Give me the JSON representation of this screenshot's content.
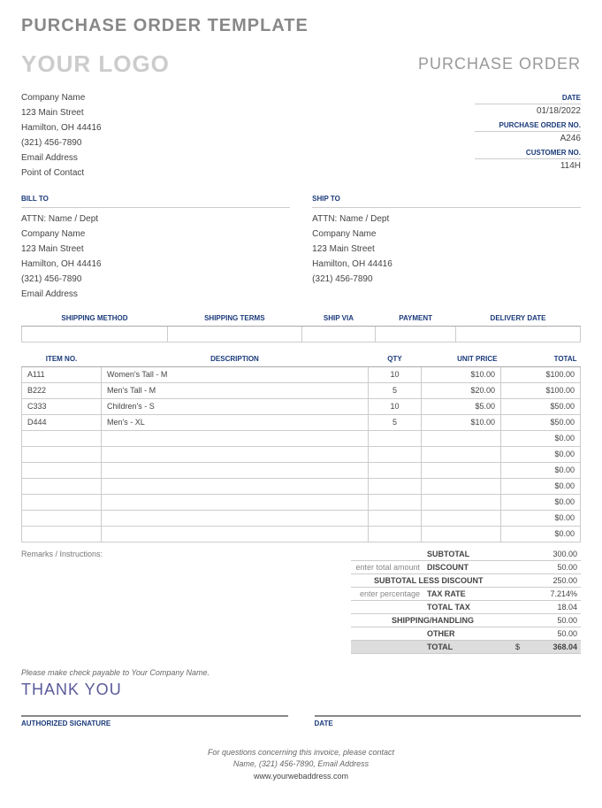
{
  "title": "PURCHASE ORDER TEMPLATE",
  "logo": "YOUR LOGO",
  "po_label": "PURCHASE ORDER",
  "company": {
    "name": "Company Name",
    "street": "123 Main Street",
    "city": "Hamilton, OH 44416",
    "phone": "(321) 456-7890",
    "email": "Email Address",
    "contact": "Point of Contact"
  },
  "meta": {
    "date_label": "DATE",
    "date": "01/18/2022",
    "po_no_label": "PURCHASE ORDER NO.",
    "po_no": "A246",
    "cust_no_label": "CUSTOMER NO.",
    "cust_no": "114H"
  },
  "bill_to": {
    "label": "BILL TO",
    "attn": "ATTN: Name / Dept",
    "company": "Company Name",
    "street": "123 Main Street",
    "city": "Hamilton, OH 44416",
    "phone": "(321) 456-7890",
    "email": "Email Address"
  },
  "ship_to": {
    "label": "SHIP TO",
    "attn": "ATTN: Name / Dept",
    "company": "Company Name",
    "street": "123 Main Street",
    "city": "Hamilton, OH 44416",
    "phone": "(321) 456-7890"
  },
  "ship_headers": {
    "method": "SHIPPING METHOD",
    "terms": "SHIPPING TERMS",
    "via": "SHIP VIA",
    "payment": "PAYMENT",
    "delivery": "DELIVERY DATE"
  },
  "item_headers": {
    "no": "ITEM NO.",
    "desc": "DESCRIPTION",
    "qty": "QTY",
    "price": "UNIT PRICE",
    "total": "TOTAL"
  },
  "items": [
    {
      "no": "A111",
      "desc": "Women's Tall - M",
      "qty": "10",
      "price": "$10.00",
      "total": "$100.00"
    },
    {
      "no": "B222",
      "desc": "Men's Tall - M",
      "qty": "5",
      "price": "$20.00",
      "total": "$100.00"
    },
    {
      "no": "C333",
      "desc": "Children's - S",
      "qty": "10",
      "price": "$5.00",
      "total": "$50.00"
    },
    {
      "no": "D444",
      "desc": "Men's - XL",
      "qty": "5",
      "price": "$10.00",
      "total": "$50.00"
    },
    {
      "no": "",
      "desc": "",
      "qty": "",
      "price": "",
      "total": "$0.00"
    },
    {
      "no": "",
      "desc": "",
      "qty": "",
      "price": "",
      "total": "$0.00"
    },
    {
      "no": "",
      "desc": "",
      "qty": "",
      "price": "",
      "total": "$0.00"
    },
    {
      "no": "",
      "desc": "",
      "qty": "",
      "price": "",
      "total": "$0.00"
    },
    {
      "no": "",
      "desc": "",
      "qty": "",
      "price": "",
      "total": "$0.00"
    },
    {
      "no": "",
      "desc": "",
      "qty": "",
      "price": "",
      "total": "$0.00"
    },
    {
      "no": "",
      "desc": "",
      "qty": "",
      "price": "",
      "total": "$0.00"
    }
  ],
  "remarks_label": "Remarks / Instructions:",
  "totals": {
    "subtotal_lbl": "SUBTOTAL",
    "subtotal": "300.00",
    "discount_note": "enter total amount",
    "discount_lbl": "DISCOUNT",
    "discount": "50.00",
    "less_lbl": "SUBTOTAL LESS DISCOUNT",
    "less": "250.00",
    "tax_note": "enter percentage",
    "tax_lbl": "TAX RATE",
    "tax": "7.214%",
    "totaltax_lbl": "TOTAL TAX",
    "totaltax": "18.04",
    "ship_lbl": "SHIPPING/HANDLING",
    "ship": "50.00",
    "other_lbl": "OTHER",
    "other": "50.00",
    "total_lbl": "TOTAL",
    "total_cur": "$",
    "total": "368.04"
  },
  "payable": "Please make check payable to Your Company Name.",
  "thanks": "THANK YOU",
  "sig": {
    "auth": "AUTHORIZED SIGNATURE",
    "date": "DATE"
  },
  "footer": {
    "line1": "For questions concerning this invoice, please contact",
    "line2": "Name, (321) 456-7890, Email Address",
    "web": "www.yourwebaddress.com"
  }
}
